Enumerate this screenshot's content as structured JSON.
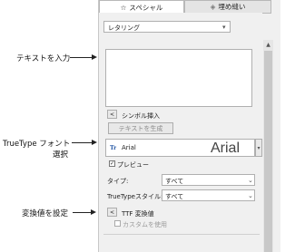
{
  "annotations": {
    "text_input": "テキストを入力",
    "truetype_font_line1": "TrueType フォント",
    "truetype_font_line2": "選択",
    "set_conversion": "変換値を設定"
  },
  "tabs": [
    {
      "label": "スペシャル",
      "icon": "star-icon"
    },
    {
      "label": "埋め縫い",
      "icon": "fill-stitch-icon"
    }
  ],
  "mode_select": {
    "value": "レタリング"
  },
  "symbol_insert": {
    "label": "シンボル挿入"
  },
  "generate_text_button": "テキストを生成",
  "font": {
    "name": "Arial",
    "preview": "Arial",
    "badge": "Tr"
  },
  "preview_checkbox": {
    "label": "プレビュー",
    "checked": true
  },
  "type_field": {
    "label": "タイプ:",
    "value": "すべて"
  },
  "truetype_style_field": {
    "label": "TrueTypeスタイル:",
    "value": "すべて"
  },
  "ttf_conversion": {
    "label": "TTF 変換値"
  },
  "use_custom_checkbox": {
    "label": "カスタムを使用",
    "checked": false
  }
}
